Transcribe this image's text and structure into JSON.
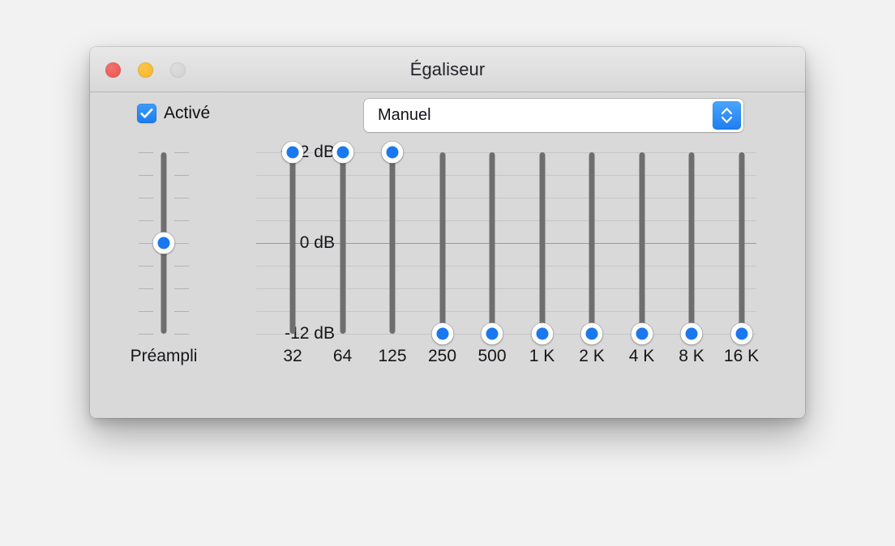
{
  "window": {
    "title": "Égaliseur",
    "traffic_lights": [
      {
        "name": "close",
        "color": "#e8504c"
      },
      {
        "name": "minimize",
        "color": "#f5b426"
      },
      {
        "name": "zoom",
        "color": "#cfcfcf"
      }
    ]
  },
  "controls": {
    "enabled_checkbox": {
      "label": "Activé",
      "checked": true,
      "accent": "#1b7cf0"
    },
    "preset": {
      "value": "Manuel",
      "stepper_icon": "chevron-up-down-icon",
      "accent": "#1d7ef1"
    }
  },
  "equalizer": {
    "preamp": {
      "caption": "Préampli",
      "value_db": 0
    },
    "scale": {
      "labels": [
        "+12 dB",
        "0 dB",
        "-12 dB"
      ],
      "max_db": 12,
      "min_db": -12,
      "gridline_count": 9,
      "major_gridline_index": 4
    },
    "bands": [
      {
        "label": "32",
        "value_db": 12
      },
      {
        "label": "64",
        "value_db": 12
      },
      {
        "label": "125",
        "value_db": 12
      },
      {
        "label": "250",
        "value_db": -12
      },
      {
        "label": "500",
        "value_db": -12
      },
      {
        "label": "1 K",
        "value_db": -12
      },
      {
        "label": "2 K",
        "value_db": -12
      },
      {
        "label": "4 K",
        "value_db": -12
      },
      {
        "label": "8 K",
        "value_db": -12
      },
      {
        "label": "16 K",
        "value_db": -12
      }
    ]
  },
  "colors": {
    "accent_blue": "#1978f0",
    "window_bg": "#d9d9d9",
    "track_gray": "#6e6e6e",
    "desktop_bg": "#f2f2f2"
  }
}
